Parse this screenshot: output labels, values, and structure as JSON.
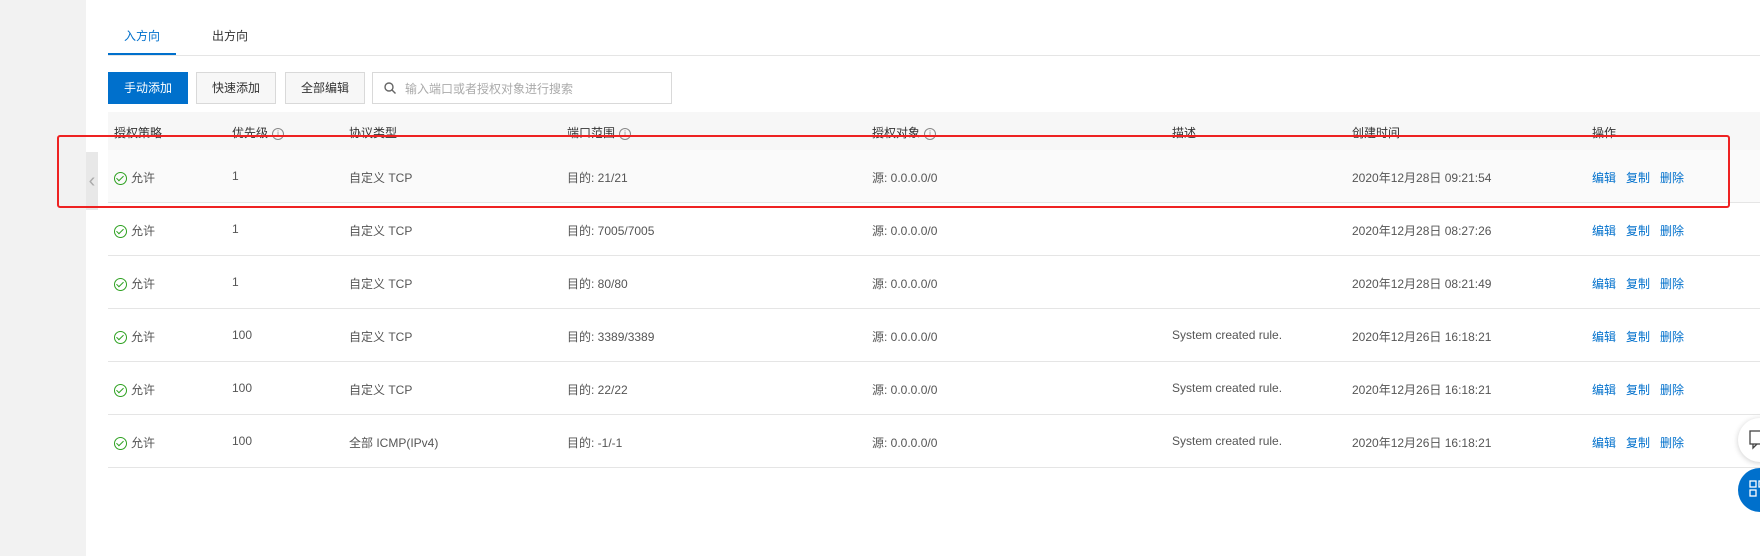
{
  "tabs": [
    {
      "label": "入方向",
      "active": true
    },
    {
      "label": "出方向",
      "active": false
    }
  ],
  "toolbar": {
    "manual_add": "手动添加",
    "quick_add": "快速添加",
    "edit_all": "全部编辑",
    "search_placeholder": "输入端口或者授权对象进行搜索"
  },
  "columns": {
    "policy": "授权策略",
    "priority": "优先级",
    "protocol": "协议类型",
    "port": "端口范围",
    "target": "授权对象",
    "desc": "描述",
    "created": "创建时间",
    "actions": "操作"
  },
  "actions": {
    "edit": "编辑",
    "copy": "复制",
    "delete": "删除"
  },
  "rows": [
    {
      "policy": "允许",
      "priority": "1",
      "protocol": "自定义 TCP",
      "port": "目的: 21/21",
      "target": "源: 0.0.0.0/0",
      "desc": "",
      "created": "2020年12月28日 09:21:54"
    },
    {
      "policy": "允许",
      "priority": "1",
      "protocol": "自定义 TCP",
      "port": "目的: 7005/7005",
      "target": "源: 0.0.0.0/0",
      "desc": "",
      "created": "2020年12月28日 08:27:26"
    },
    {
      "policy": "允许",
      "priority": "1",
      "protocol": "自定义 TCP",
      "port": "目的: 80/80",
      "target": "源: 0.0.0.0/0",
      "desc": "",
      "created": "2020年12月28日 08:21:49"
    },
    {
      "policy": "允许",
      "priority": "100",
      "protocol": "自定义 TCP",
      "port": "目的: 3389/3389",
      "target": "源: 0.0.0.0/0",
      "desc": "System created rule.",
      "created": "2020年12月26日 16:18:21"
    },
    {
      "policy": "允许",
      "priority": "100",
      "protocol": "自定义 TCP",
      "port": "目的: 22/22",
      "target": "源: 0.0.0.0/0",
      "desc": "System created rule.",
      "created": "2020年12月26日 16:18:21"
    },
    {
      "policy": "允许",
      "priority": "100",
      "protocol": "全部 ICMP(IPv4)",
      "port": "目的: -1/-1",
      "target": "源: 0.0.0.0/0",
      "desc": "System created rule.",
      "created": "2020年12月26日 16:18:21"
    }
  ],
  "colors": {
    "accent": "#0070cc",
    "allow": "#2ea121",
    "highlight": "#e22222"
  }
}
